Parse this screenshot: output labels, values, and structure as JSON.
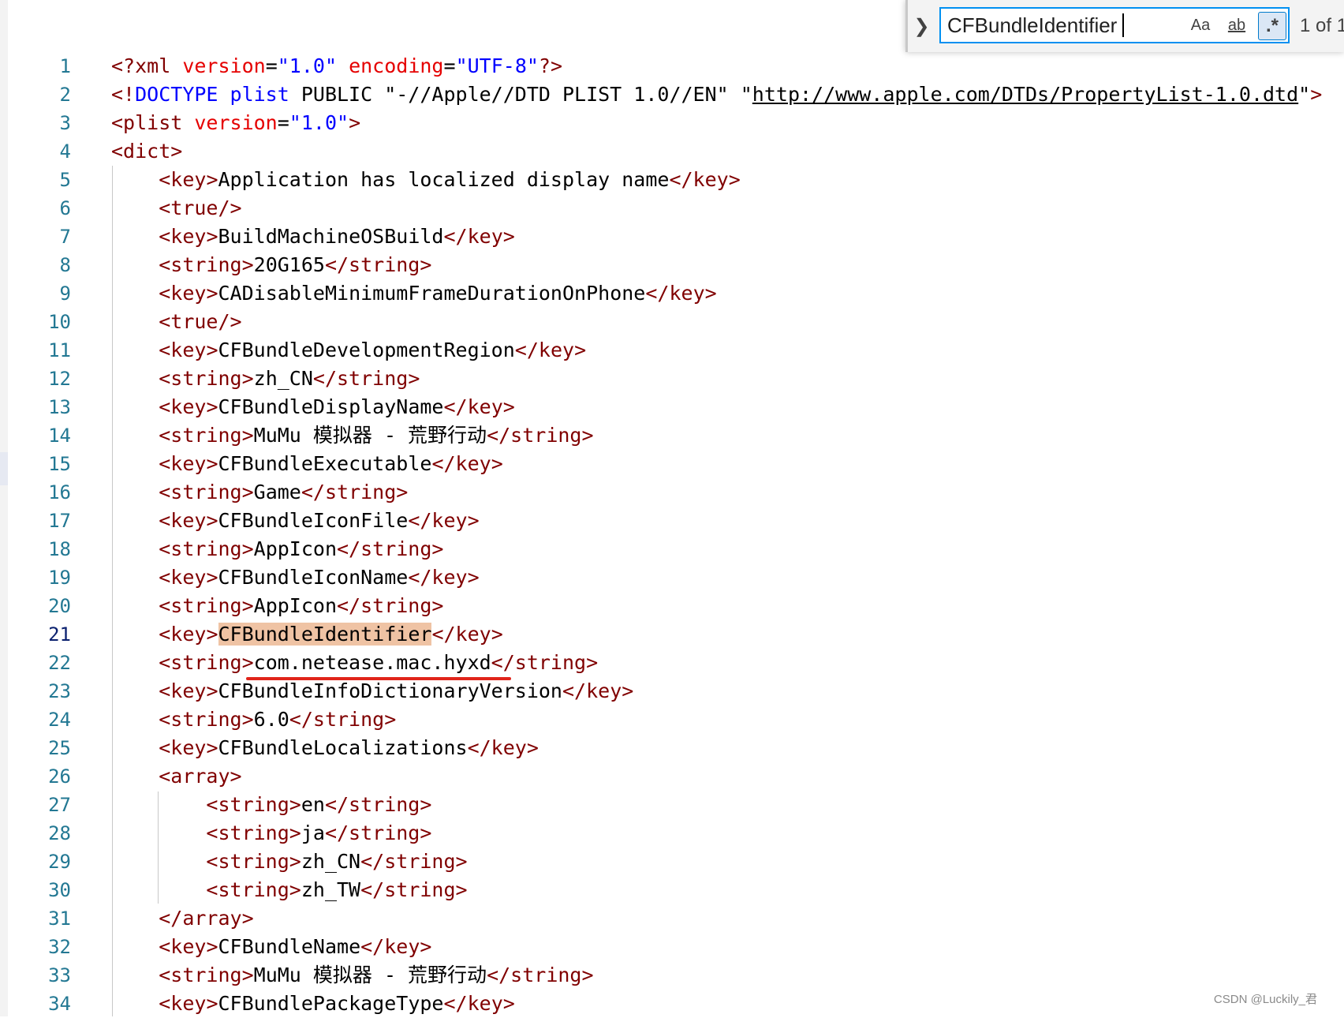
{
  "find": {
    "query": "CFBundleIdentifier",
    "match_case_label": "Aa",
    "whole_word_label": "ab",
    "regex_label": ".*",
    "match_count": "1 of 1"
  },
  "editor": {
    "active_line": 21,
    "lines": [
      {
        "n": "1",
        "code": "<?xml version=\"1.0\" encoding=\"UTF-8\"?>"
      },
      {
        "n": "2",
        "code": "<!DOCTYPE plist PUBLIC \"-//Apple//DTD PLIST 1.0//EN\" \"http://www.apple.com/DTDs/PropertyList-1.0.dtd\">"
      },
      {
        "n": "3",
        "code": "<plist version=\"1.0\">"
      },
      {
        "n": "4",
        "code": "<dict>"
      },
      {
        "n": "5",
        "code": "    <key>Application has localized display name</key>"
      },
      {
        "n": "6",
        "code": "    <true/>"
      },
      {
        "n": "7",
        "code": "    <key>BuildMachineOSBuild</key>"
      },
      {
        "n": "8",
        "code": "    <string>20G165</string>"
      },
      {
        "n": "9",
        "code": "    <key>CADisableMinimumFrameDurationOnPhone</key>"
      },
      {
        "n": "10",
        "code": "    <true/>"
      },
      {
        "n": "11",
        "code": "    <key>CFBundleDevelopmentRegion</key>"
      },
      {
        "n": "12",
        "code": "    <string>zh_CN</string>"
      },
      {
        "n": "13",
        "code": "    <key>CFBundleDisplayName</key>"
      },
      {
        "n": "14",
        "code": "    <string>MuMu 模拟器 - 荒野行动</string>"
      },
      {
        "n": "15",
        "code": "    <key>CFBundleExecutable</key>"
      },
      {
        "n": "16",
        "code": "    <string>Game</string>"
      },
      {
        "n": "17",
        "code": "    <key>CFBundleIconFile</key>"
      },
      {
        "n": "18",
        "code": "    <string>AppIcon</string>"
      },
      {
        "n": "19",
        "code": "    <key>CFBundleIconName</key>"
      },
      {
        "n": "20",
        "code": "    <string>AppIcon</string>"
      },
      {
        "n": "21",
        "code": "    <key>CFBundleIdentifier</key>"
      },
      {
        "n": "22",
        "code": "    <string>com.netease.mac.hyxd</string>"
      },
      {
        "n": "23",
        "code": "    <key>CFBundleInfoDictionaryVersion</key>"
      },
      {
        "n": "24",
        "code": "    <string>6.0</string>"
      },
      {
        "n": "25",
        "code": "    <key>CFBundleLocalizations</key>"
      },
      {
        "n": "26",
        "code": "    <array>"
      },
      {
        "n": "27",
        "code": "        <string>en</string>"
      },
      {
        "n": "28",
        "code": "        <string>ja</string>"
      },
      {
        "n": "29",
        "code": "        <string>zh_CN</string>"
      },
      {
        "n": "30",
        "code": "        <string>zh_TW</string>"
      },
      {
        "n": "31",
        "code": "    </array>"
      },
      {
        "n": "32",
        "code": "    <key>CFBundleName</key>"
      },
      {
        "n": "33",
        "code": "    <string>MuMu 模拟器 - 荒野行动</string>"
      },
      {
        "n": "34",
        "code": "    <key>CFBundlePackageType</key>"
      }
    ]
  },
  "colors": {
    "tag": "#800000",
    "attribute": "#e50000",
    "attribute_value": "#0000ff",
    "line_number": "#237893",
    "find_highlight": "#efc3a4",
    "find_border": "#0090f1",
    "annotation_underline": "#e0241b"
  },
  "watermark": "CSDN @Luckily_君"
}
